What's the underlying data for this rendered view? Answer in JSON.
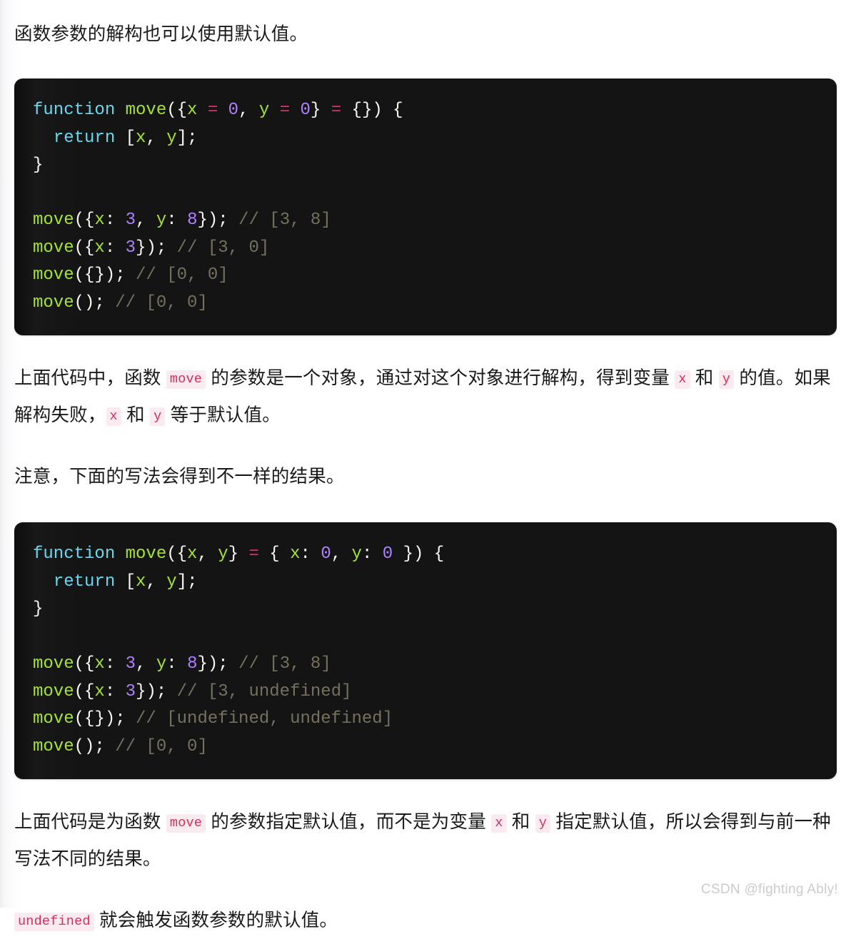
{
  "article": {
    "intro_paragraph": "函数参数的解构也可以使用默认值。",
    "note_paragraph": "注意，下面的写法会得到不一样的结果。",
    "explain_1": {
      "part_1": "上面代码中，函数 ",
      "code_move": "move",
      "part_2": " 的参数是一个对象，通过对这个对象进行解构，得到变量 ",
      "code_x": "x",
      "part_3": " 和 ",
      "code_y": "y",
      "part_4": " 的值。如果解构失败，",
      "code_x2": "x",
      "part_5": " 和 ",
      "code_y2": "y",
      "part_6": " 等于默认值。"
    },
    "explain_2": {
      "part_1": "上面代码是为函数 ",
      "code_move": "move",
      "part_2": " 的参数指定默认值，而不是为变量 ",
      "code_x": "x",
      "part_3": " 和 ",
      "code_y": "y",
      "part_4": " 指定默认值，所以会得到与前一种写法不同的结果。"
    },
    "explain_3": {
      "code_undefined": "undefined",
      "part_1": " 就会触发函数参数的默认值。"
    }
  },
  "code_block_1": {
    "language": "javascript",
    "lines": [
      "function move({x = 0, y = 0} = {}) {",
      "  return [x, y];",
      "}",
      "",
      "move({x: 3, y: 8}); // [3, 8]",
      "move({x: 3}); // [3, 0]",
      "move({}); // [0, 0]",
      "move(); // [0, 0]"
    ],
    "tokens": {
      "l1": [
        {
          "t": "function",
          "c": "kw"
        },
        {
          "t": " ",
          "c": "pun"
        },
        {
          "t": "move",
          "c": "fn"
        },
        {
          "t": "({",
          "c": "pun"
        },
        {
          "t": "x",
          "c": "var"
        },
        {
          "t": " ",
          "c": "pun"
        },
        {
          "t": "=",
          "c": "op"
        },
        {
          "t": " ",
          "c": "pun"
        },
        {
          "t": "0",
          "c": "num"
        },
        {
          "t": ", ",
          "c": "pun"
        },
        {
          "t": "y",
          "c": "var"
        },
        {
          "t": " ",
          "c": "pun"
        },
        {
          "t": "=",
          "c": "op"
        },
        {
          "t": " ",
          "c": "pun"
        },
        {
          "t": "0",
          "c": "num"
        },
        {
          "t": "} ",
          "c": "pun"
        },
        {
          "t": "=",
          "c": "op"
        },
        {
          "t": " {}) {",
          "c": "pun"
        }
      ],
      "l2": [
        {
          "t": "  ",
          "c": "pun"
        },
        {
          "t": "return",
          "c": "kw"
        },
        {
          "t": " [",
          "c": "pun"
        },
        {
          "t": "x",
          "c": "var"
        },
        {
          "t": ", ",
          "c": "pun"
        },
        {
          "t": "y",
          "c": "var"
        },
        {
          "t": "];",
          "c": "pun"
        }
      ],
      "l3": [
        {
          "t": "}",
          "c": "pun"
        }
      ],
      "l4": [],
      "l5": [
        {
          "t": "move",
          "c": "fn"
        },
        {
          "t": "({",
          "c": "pun"
        },
        {
          "t": "x",
          "c": "var"
        },
        {
          "t": ": ",
          "c": "pun"
        },
        {
          "t": "3",
          "c": "num"
        },
        {
          "t": ", ",
          "c": "pun"
        },
        {
          "t": "y",
          "c": "var"
        },
        {
          "t": ": ",
          "c": "pun"
        },
        {
          "t": "8",
          "c": "num"
        },
        {
          "t": "}); ",
          "c": "pun"
        },
        {
          "t": "// [3, 8]",
          "c": "cmt"
        }
      ],
      "l6": [
        {
          "t": "move",
          "c": "fn"
        },
        {
          "t": "({",
          "c": "pun"
        },
        {
          "t": "x",
          "c": "var"
        },
        {
          "t": ": ",
          "c": "pun"
        },
        {
          "t": "3",
          "c": "num"
        },
        {
          "t": "}); ",
          "c": "pun"
        },
        {
          "t": "// [3, 0]",
          "c": "cmt"
        }
      ],
      "l7": [
        {
          "t": "move",
          "c": "fn"
        },
        {
          "t": "({}); ",
          "c": "pun"
        },
        {
          "t": "// [0, 0]",
          "c": "cmt"
        }
      ],
      "l8": [
        {
          "t": "move",
          "c": "fn"
        },
        {
          "t": "(); ",
          "c": "pun"
        },
        {
          "t": "// [0, 0]",
          "c": "cmt"
        }
      ]
    }
  },
  "code_block_2": {
    "language": "javascript",
    "lines": [
      "function move({x, y} = { x: 0, y: 0 }) {",
      "  return [x, y];",
      "}",
      "",
      "move({x: 3, y: 8}); // [3, 8]",
      "move({x: 3}); // [3, undefined]",
      "move({}); // [undefined, undefined]",
      "move(); // [0, 0]"
    ],
    "tokens": {
      "l1": [
        {
          "t": "function",
          "c": "kw"
        },
        {
          "t": " ",
          "c": "pun"
        },
        {
          "t": "move",
          "c": "fn"
        },
        {
          "t": "({",
          "c": "pun"
        },
        {
          "t": "x",
          "c": "var"
        },
        {
          "t": ", ",
          "c": "pun"
        },
        {
          "t": "y",
          "c": "var"
        },
        {
          "t": "} ",
          "c": "pun"
        },
        {
          "t": "=",
          "c": "op"
        },
        {
          "t": " { ",
          "c": "pun"
        },
        {
          "t": "x",
          "c": "var"
        },
        {
          "t": ": ",
          "c": "pun"
        },
        {
          "t": "0",
          "c": "num"
        },
        {
          "t": ", ",
          "c": "pun"
        },
        {
          "t": "y",
          "c": "var"
        },
        {
          "t": ": ",
          "c": "pun"
        },
        {
          "t": "0",
          "c": "num"
        },
        {
          "t": " }) {",
          "c": "pun"
        }
      ],
      "l2": [
        {
          "t": "  ",
          "c": "pun"
        },
        {
          "t": "return",
          "c": "kw"
        },
        {
          "t": " [",
          "c": "pun"
        },
        {
          "t": "x",
          "c": "var"
        },
        {
          "t": ", ",
          "c": "pun"
        },
        {
          "t": "y",
          "c": "var"
        },
        {
          "t": "];",
          "c": "pun"
        }
      ],
      "l3": [
        {
          "t": "}",
          "c": "pun"
        }
      ],
      "l4": [],
      "l5": [
        {
          "t": "move",
          "c": "fn"
        },
        {
          "t": "({",
          "c": "pun"
        },
        {
          "t": "x",
          "c": "var"
        },
        {
          "t": ": ",
          "c": "pun"
        },
        {
          "t": "3",
          "c": "num"
        },
        {
          "t": ", ",
          "c": "pun"
        },
        {
          "t": "y",
          "c": "var"
        },
        {
          "t": ": ",
          "c": "pun"
        },
        {
          "t": "8",
          "c": "num"
        },
        {
          "t": "}); ",
          "c": "pun"
        },
        {
          "t": "// [3, 8]",
          "c": "cmt"
        }
      ],
      "l6": [
        {
          "t": "move",
          "c": "fn"
        },
        {
          "t": "({",
          "c": "pun"
        },
        {
          "t": "x",
          "c": "var"
        },
        {
          "t": ": ",
          "c": "pun"
        },
        {
          "t": "3",
          "c": "num"
        },
        {
          "t": "}); ",
          "c": "pun"
        },
        {
          "t": "// [3, undefined]",
          "c": "cmt"
        }
      ],
      "l7": [
        {
          "t": "move",
          "c": "fn"
        },
        {
          "t": "({}); ",
          "c": "pun"
        },
        {
          "t": "// [undefined, undefined]",
          "c": "cmt"
        }
      ],
      "l8": [
        {
          "t": "move",
          "c": "fn"
        },
        {
          "t": "(); ",
          "c": "pun"
        },
        {
          "t": "// [0, 0]",
          "c": "cmt"
        }
      ]
    }
  },
  "watermark": {
    "text": "CSDN @fighting Ably!"
  },
  "colors": {
    "page_background": "#ffffff",
    "code_background": "#141414",
    "keyword": "#66d9ef",
    "function_name": "#a6e22e",
    "variable": "#a6e22e",
    "operator": "#e02f63",
    "number": "#ae81ff",
    "punctuation": "#f8f8f2",
    "comment": "#75715e",
    "inline_code_text": "#d4305a",
    "inline_code_background": "#fbeaef",
    "body_text": "#1a1a1a",
    "watermark_text": "#c9cccf"
  }
}
